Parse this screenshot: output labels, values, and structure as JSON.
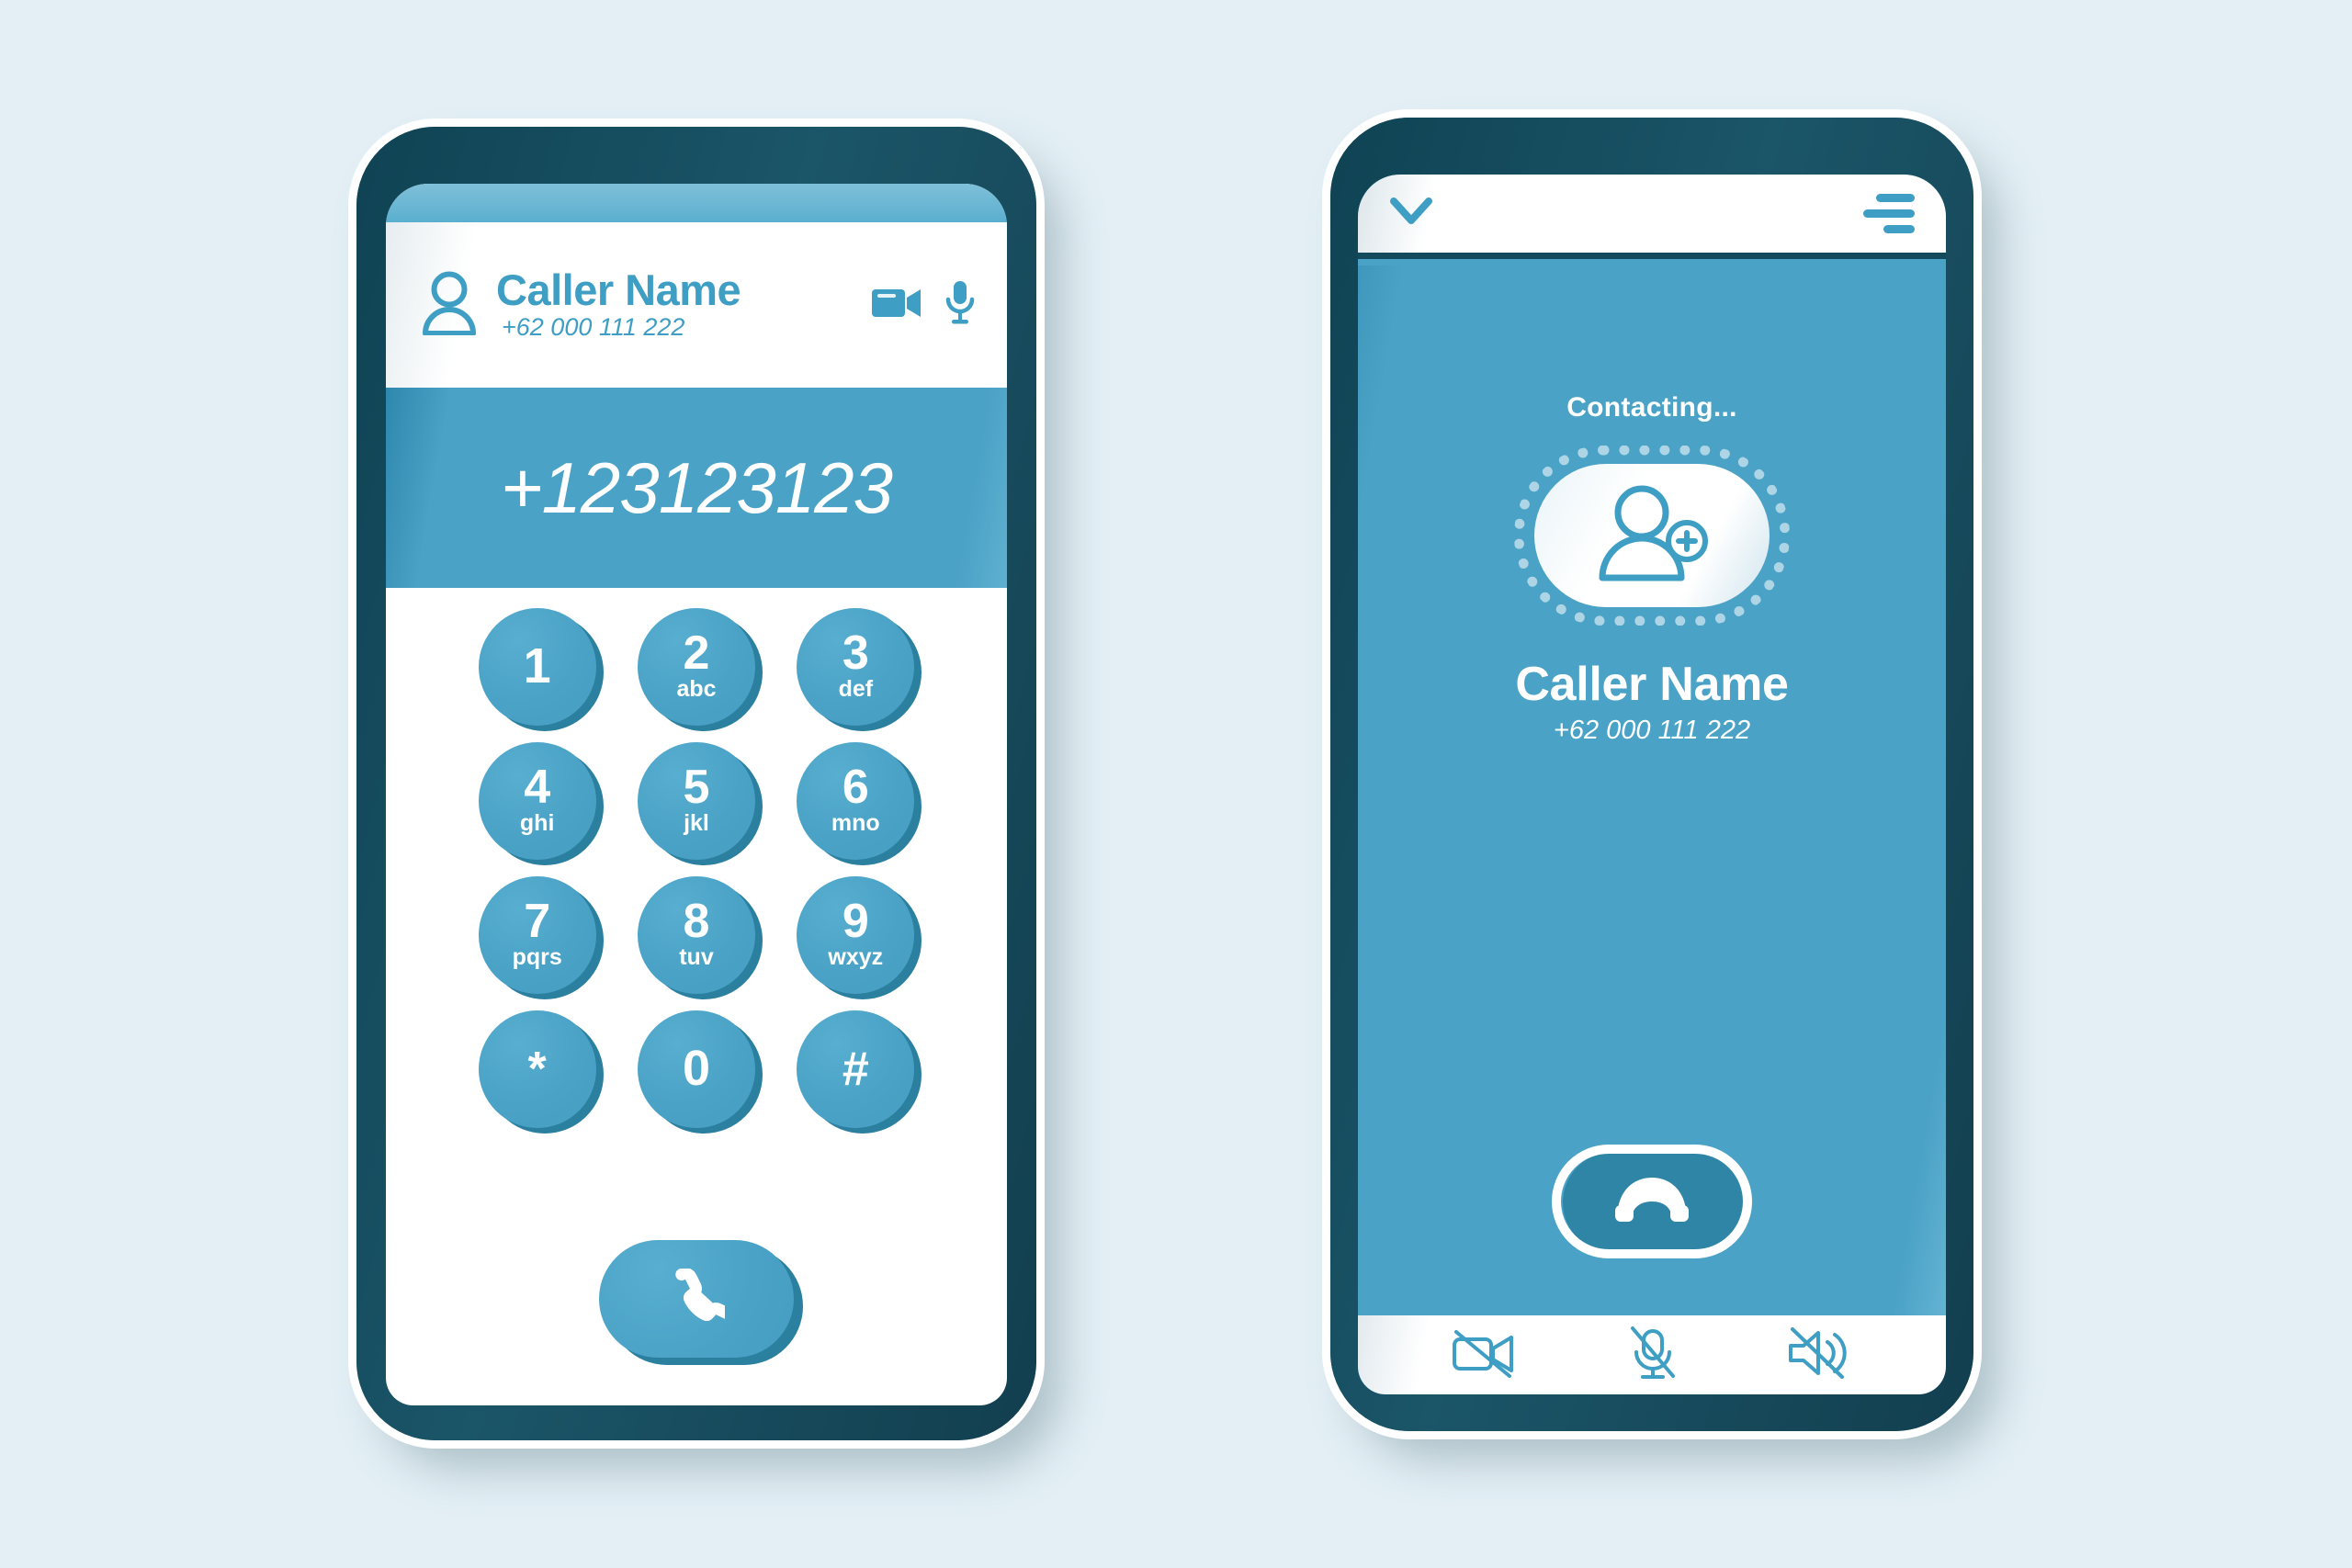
{
  "background_color": "#e3eff5",
  "colors": {
    "primary_blue": "#4aa2c6",
    "icon_blue": "#3f9ec3",
    "bezel_navy": "#134a5c",
    "white": "#ffffff"
  },
  "dialer_phone": {
    "header": {
      "avatar_icon": "person-icon",
      "caller_name": "Caller Name",
      "caller_number": "+62 000 111 222",
      "video_icon": "video-camera-icon",
      "mic_icon": "microphone-icon"
    },
    "dialed_number": "+123123123",
    "keypad": [
      {
        "digit": "1",
        "letters": ""
      },
      {
        "digit": "2",
        "letters": "abc"
      },
      {
        "digit": "3",
        "letters": "def"
      },
      {
        "digit": "4",
        "letters": "ghi"
      },
      {
        "digit": "5",
        "letters": "jkl"
      },
      {
        "digit": "6",
        "letters": "mno"
      },
      {
        "digit": "7",
        "letters": "pqrs"
      },
      {
        "digit": "8",
        "letters": "tuv"
      },
      {
        "digit": "9",
        "letters": "wxyz"
      },
      {
        "digit": "*",
        "letters": ""
      },
      {
        "digit": "0",
        "letters": ""
      },
      {
        "digit": "#",
        "letters": ""
      }
    ],
    "call_button_icon": "phone-handset-icon"
  },
  "calling_phone": {
    "topbar": {
      "collapse_icon": "chevron-down-icon",
      "menu_icon": "hamburger-menu-icon"
    },
    "status_text": "Contacting...",
    "avatar_icon": "add-person-icon",
    "caller_name": "Caller Name",
    "caller_number": "+62 000 111 222",
    "end_call_icon": "phone-hangup-icon",
    "toolbar": [
      {
        "icon": "video-off-icon"
      },
      {
        "icon": "microphone-off-icon"
      },
      {
        "icon": "speaker-off-icon"
      }
    ]
  }
}
